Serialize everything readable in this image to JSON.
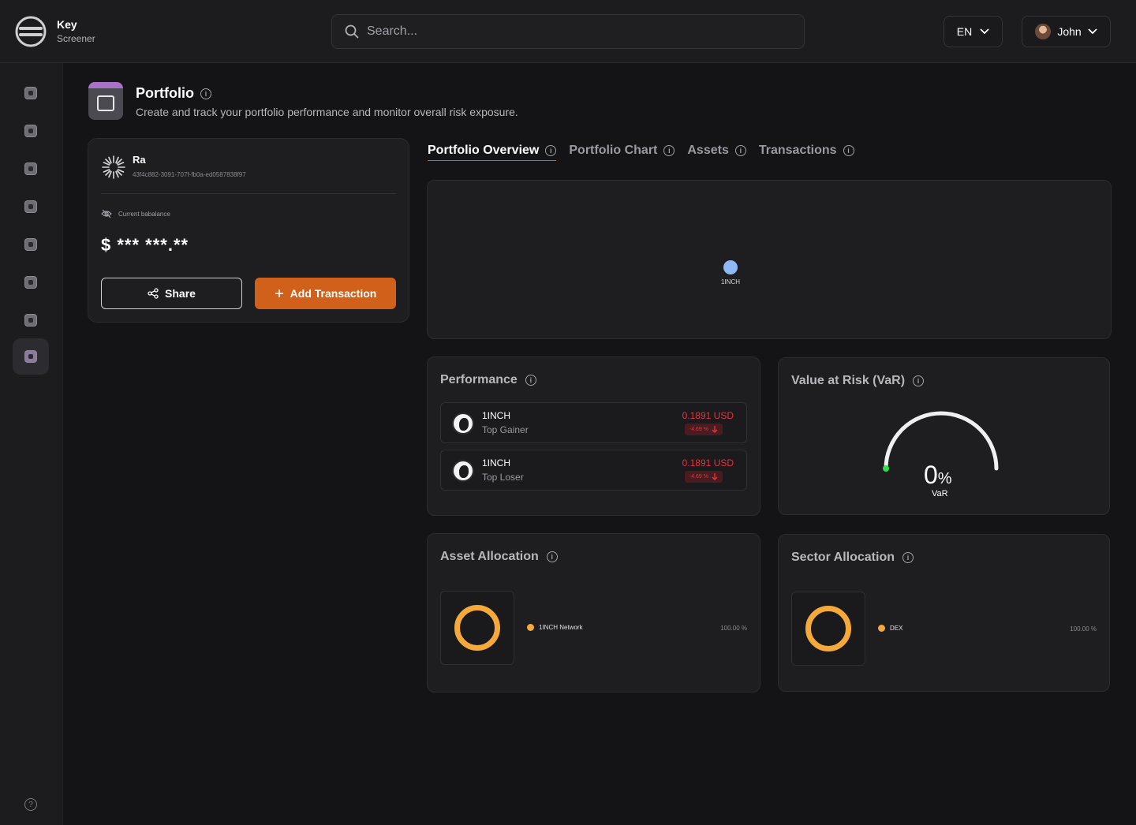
{
  "brand": {
    "line1": "Key",
    "line2": "Screener"
  },
  "search": {
    "placeholder": "Search..."
  },
  "header": {
    "language": "EN",
    "user_name": "John"
  },
  "page": {
    "title": "Portfolio",
    "subtitle": "Create and track your portfolio performance and monitor overall risk exposure."
  },
  "account": {
    "name": "Ra",
    "id": "43f4c882-3091-707f-fb0a-ed0587838f97",
    "balance_label": "Current babalance",
    "balance_masked": "$ *** ***.**",
    "share_label": "Share",
    "add_label": "Add Transaction"
  },
  "tabs": [
    {
      "label": "Portfolio Overview",
      "active": true
    },
    {
      "label": "Portfolio Chart",
      "active": false
    },
    {
      "label": "Assets",
      "active": false
    },
    {
      "label": "Transactions",
      "active": false
    }
  ],
  "bubble": {
    "label": "1INCH",
    "color": "#8fb8f6"
  },
  "performance": {
    "title": "Performance",
    "rows": [
      {
        "name": "1INCH",
        "sub": "Top Gainer",
        "price": "0.1891 USD",
        "change": "-4.69 %"
      },
      {
        "name": "1INCH",
        "sub": "Top Loser",
        "price": "0.1891 USD",
        "change": "-4.69 %"
      }
    ]
  },
  "var": {
    "title": "Value at Risk (VaR)",
    "value": "0",
    "unit": "%",
    "label": "VaR",
    "level": 0
  },
  "asset_allocation": {
    "title": "Asset Allocation",
    "item": "1INCH Network",
    "pct": "100.00 %",
    "color": "#f5a93b"
  },
  "sector_allocation": {
    "title": "Sector Allocation",
    "item": "DEX",
    "pct": "100.00 %",
    "color": "#f5a93b"
  },
  "colors": {
    "accent": "#d0601a",
    "negative": "#e0343f",
    "gauge_dot": "#2ee04a"
  }
}
